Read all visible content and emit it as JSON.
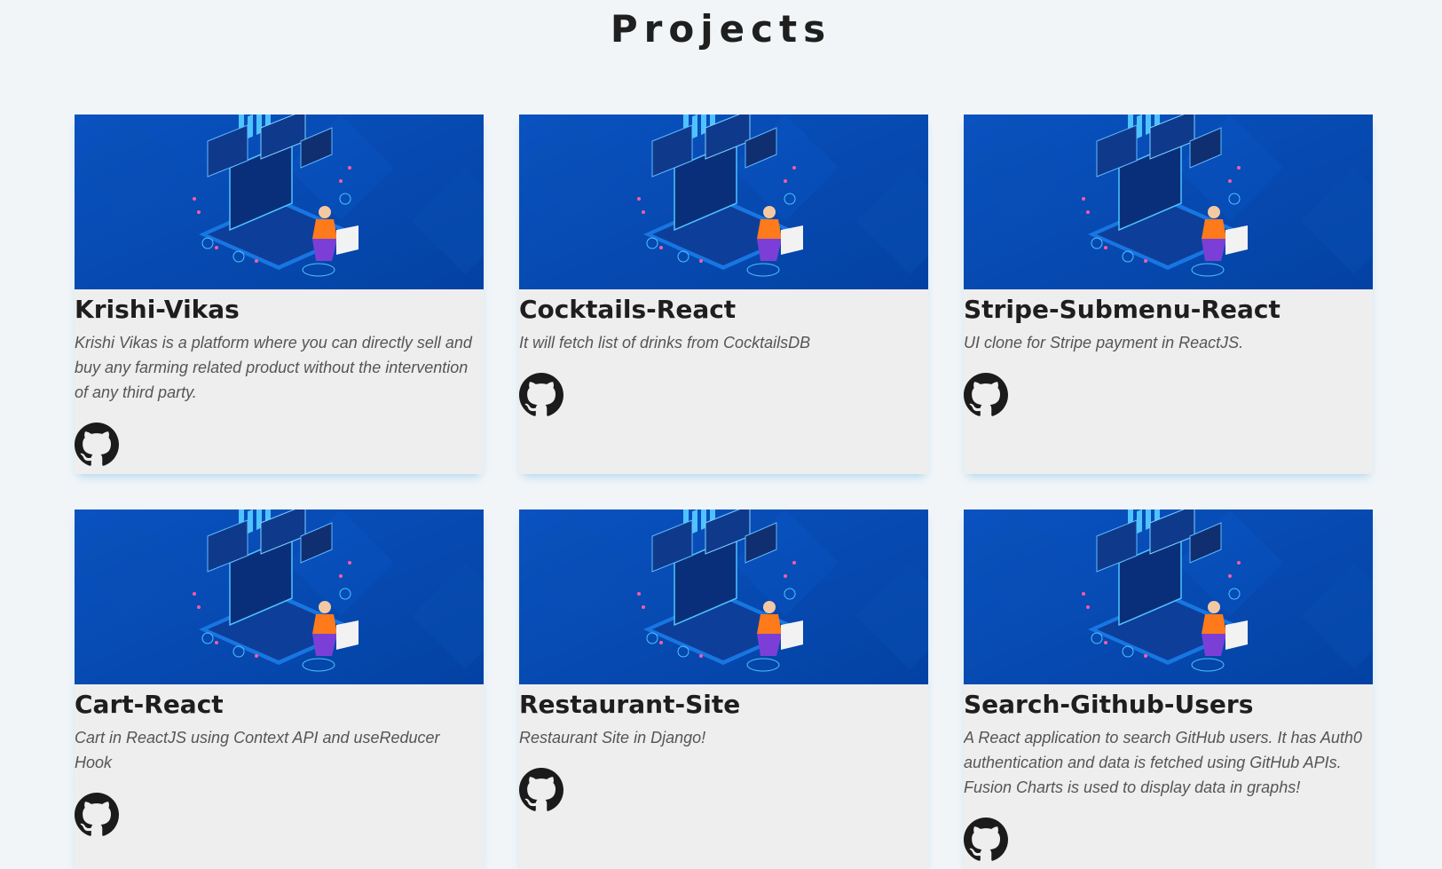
{
  "header": {
    "title": "Projects"
  },
  "projects": [
    {
      "title": "Krishi-Vikas",
      "description": "Krishi Vikas is a platform where you can directly sell and buy any farming related product without the intervention of any third party.",
      "link_icon": "github-icon"
    },
    {
      "title": "Cocktails-React",
      "description": "It will fetch list of drinks from CocktailsDB",
      "link_icon": "github-icon"
    },
    {
      "title": "Stripe-Submenu-React",
      "description": "UI clone for Stripe payment in ReactJS.",
      "link_icon": "github-icon"
    },
    {
      "title": "Cart-React",
      "description": "Cart in ReactJS using Context API and useReducer Hook",
      "link_icon": "github-icon"
    },
    {
      "title": "Restaurant-Site",
      "description": "Restaurant Site in Django!",
      "link_icon": "github-icon"
    },
    {
      "title": "Search-Github-Users",
      "description": "A React application to search GitHub users. It has Auth0 authentication and data is fetched using GitHub APIs. Fusion Charts is used to display data in graphs!",
      "link_icon": "github-icon"
    }
  ],
  "colors": {
    "background": "#f1f5f8",
    "card": "#eeeeee",
    "thumb": "#0759c9",
    "accent": "#ff7a1a"
  }
}
